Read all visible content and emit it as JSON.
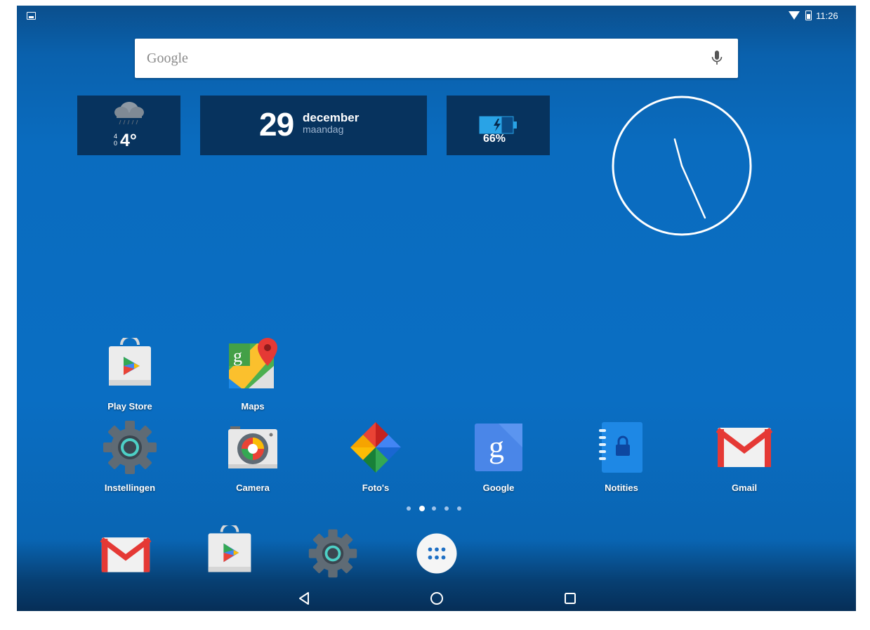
{
  "status_bar": {
    "time": "11:26",
    "icons": [
      "notification-image-icon",
      "wifi-icon",
      "battery-icon"
    ]
  },
  "search": {
    "logo": "Google",
    "icon": "mic-icon"
  },
  "widgets": {
    "weather": {
      "small_top": "4",
      "small_bottom": "0",
      "temperature": "4°",
      "icon": "rain-cloud-icon"
    },
    "date": {
      "day": "29",
      "month": "december",
      "weekday": "maandag"
    },
    "battery": {
      "percent": "66%",
      "level": 0.66,
      "icon": "battery-charging-icon"
    },
    "clock": {
      "hour_hand_deg": 345,
      "minute_hand_deg": 156
    }
  },
  "apps": {
    "row1": [
      {
        "label": "Play Store",
        "icon": "play-store-icon"
      },
      {
        "label": "Maps",
        "icon": "maps-icon"
      }
    ],
    "row2": [
      {
        "label": "Instellingen",
        "icon": "settings-icon"
      },
      {
        "label": "Camera",
        "icon": "camera-icon"
      },
      {
        "label": "Foto's",
        "icon": "photos-icon"
      },
      {
        "label": "Google",
        "icon": "google-icon"
      },
      {
        "label": "Notities",
        "icon": "notes-icon"
      },
      {
        "label": "Gmail",
        "icon": "gmail-icon"
      }
    ]
  },
  "page_indicator": {
    "count": 5,
    "active": 1
  },
  "dock": [
    "gmail-icon",
    "play-store-icon",
    "settings-icon",
    "app-drawer-icon"
  ],
  "nav": [
    "back-icon",
    "home-icon",
    "recents-icon"
  ],
  "colors": {
    "wallpaper": "#0a6ec3",
    "widget_bg": "#07335e",
    "accent_teal": "#4dd0c6"
  }
}
